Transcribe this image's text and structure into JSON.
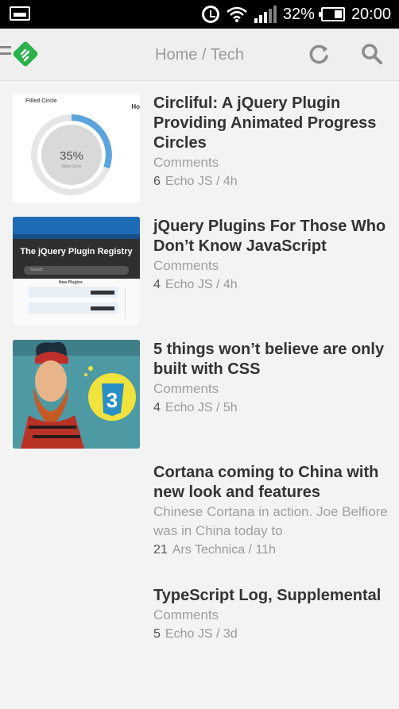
{
  "status": {
    "battery_pct": "32%",
    "time": "20:00"
  },
  "toolbar": {
    "breadcrumb": "Home / Tech"
  },
  "items": [
    {
      "title": "Circliful: A jQuery Plugin Providing Animated Progress Circles",
      "subtitle": "Comments",
      "count": "6",
      "source": "Echo JS / 4h",
      "thumb": {
        "label": "Filled Circle",
        "label2": "Ho",
        "percent": "35%",
        "caption": "Slow Circle"
      }
    },
    {
      "title": "jQuery Plugins For Those Who Don’t Know JavaScript",
      "subtitle": "Comments",
      "count": "4",
      "source": "Echo JS / 4h",
      "thumb": {
        "heading": "The jQuery Plugin Registry",
        "search": "Search",
        "section": "New Plugins"
      }
    },
    {
      "title": "5 things won’t believe are only built with CSS",
      "subtitle": "Comments",
      "count": "4",
      "source": "Echo JS / 5h"
    },
    {
      "title": "Cortana coming to China with new look and features",
      "subtitle": "Chinese Cortana in action. Joe Belfiore was in China today to",
      "count": "21",
      "source": "Ars Technica / 11h"
    },
    {
      "title": "TypeScript Log, Supplemental",
      "subtitle": "Comments",
      "count": "5",
      "source": "Echo JS / 3d"
    }
  ],
  "colors": {
    "accent_green": "#2bb24c",
    "icon_gray": "#888888",
    "progress_blue": "#5aa5e0"
  }
}
